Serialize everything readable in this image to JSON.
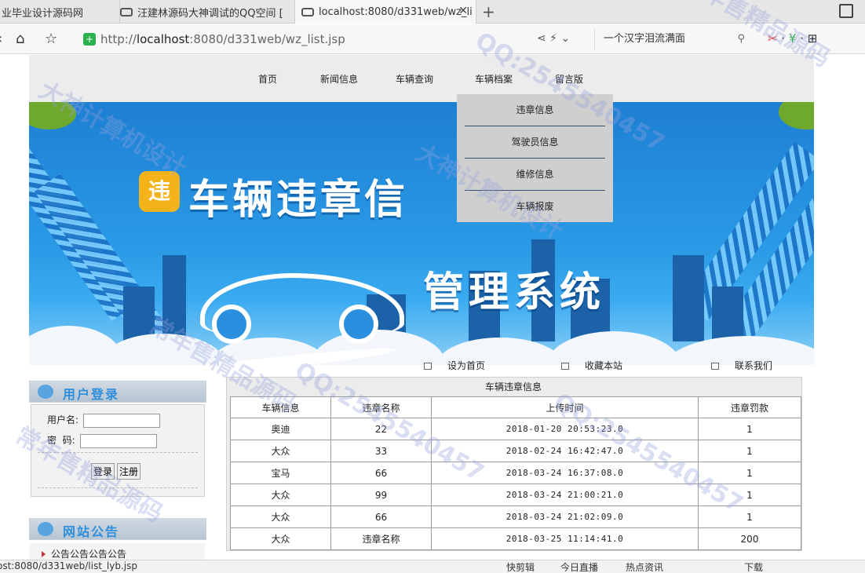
{
  "browser": {
    "tabs": [
      {
        "label": "业毕业设计源码网"
      },
      {
        "label": "汪建林源码大神调试的QQ空间 ["
      },
      {
        "label": "localhost:8080/d331web/wz_li"
      }
    ],
    "close_glyph": "✕",
    "new_tab_glyph": "+",
    "url_prefix": "http://",
    "url_host": "localhost",
    "url_rest": ":8080/d331web/wz_list.jsp",
    "search_text": "一个汉字泪流满面",
    "status_url": "ost:8080/d331web/list_lyb.jsp",
    "status_items": [
      "快剪辑",
      "今日直播",
      "热点资讯",
      "下载"
    ]
  },
  "nav": {
    "items": [
      "首页",
      "新闻信息",
      "车辆查询",
      "车辆档案",
      "留言版"
    ],
    "dropdown": [
      "违章信息",
      "驾驶员信息",
      "维修信息",
      "车辆报废"
    ]
  },
  "banner": {
    "badge": "违",
    "title_line1": "车辆违章信",
    "title_line2": "管理系统"
  },
  "utility": {
    "set_home": "设为首页",
    "bookmark": "收藏本站",
    "contact": "联系我们"
  },
  "login": {
    "title": "用户登录",
    "username_label": "用户名:",
    "password_label": "密  码:",
    "login_button": "登录",
    "register_button": "注册"
  },
  "notice": {
    "title": "网站公告",
    "items": [
      "公告公告公告公告"
    ]
  },
  "table": {
    "title": "车辆违章信息",
    "headers": [
      "车辆信息",
      "违章名称",
      "上传时间",
      "违章罚款"
    ],
    "rows": [
      [
        "奥迪",
        "22",
        "2018-01-20 20:53:23.0",
        "1"
      ],
      [
        "大众",
        "33",
        "2018-02-24 16:42:47.0",
        "1"
      ],
      [
        "宝马",
        "66",
        "2018-03-24 16:37:08.0",
        "1"
      ],
      [
        "大众",
        "99",
        "2018-03-24 21:00:21.0",
        "1"
      ],
      [
        "大众",
        "66",
        "2018-03-24 21:02:09.0",
        "1"
      ],
      [
        "大众",
        "违章名称",
        "2018-03-25 11:14:41.0",
        "200"
      ]
    ]
  },
  "watermark": {
    "texts": [
      "常年售精品源码",
      "QQ:2545540457",
      "大神计算机设计",
      "常年售精品源码",
      "QQ:2545540457",
      "大神计算机设计",
      "QQ:2545540457",
      "常年售精品源码"
    ]
  },
  "colors": {
    "accent": "#2d8fdc",
    "nav_bg": "#ececec",
    "dropdown_bg": "#cfcfcf",
    "secure": "#2bb24c"
  }
}
